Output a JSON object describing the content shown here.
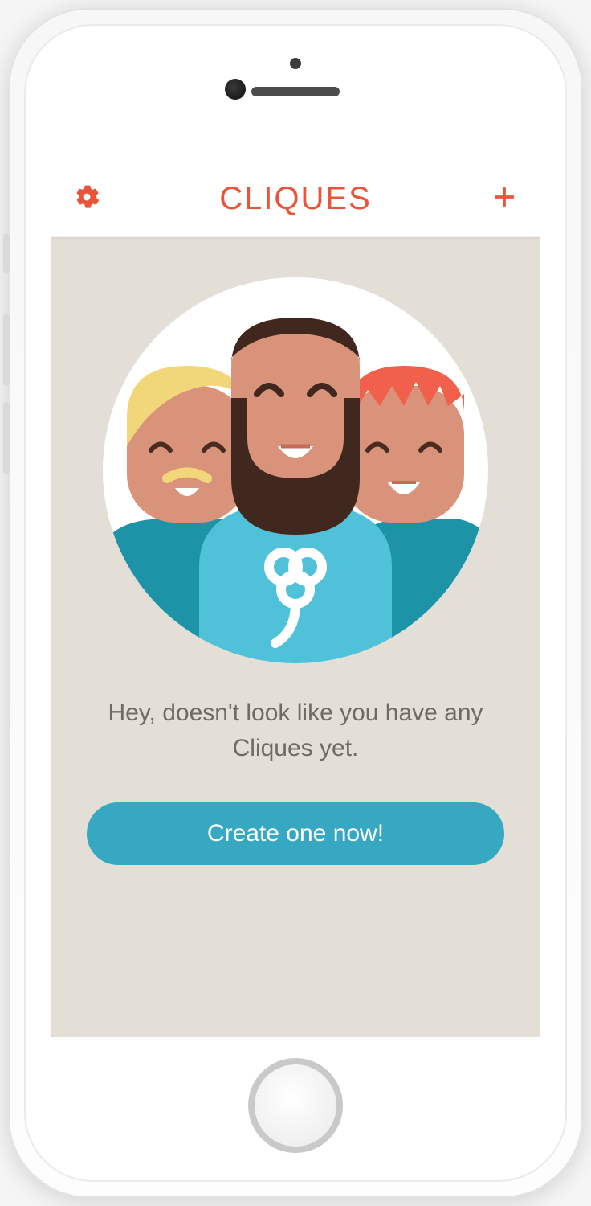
{
  "navbar": {
    "title": "CLIQUES",
    "settings_icon": "gear-icon",
    "add_icon": "plus-icon"
  },
  "empty_state": {
    "message": "Hey, doesn't look like you have any Cliques yet.",
    "cta_label": "Create one now!"
  },
  "colors": {
    "accent": "#e8553a",
    "button": "#36a8c1",
    "background": "#e3dfd6"
  }
}
